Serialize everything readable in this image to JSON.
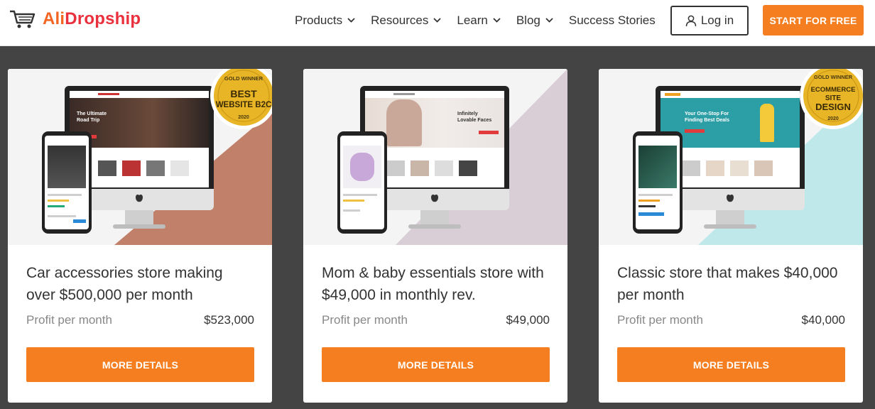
{
  "header": {
    "brand": {
      "part1": "Ali",
      "part2": "Dropship"
    },
    "nav": [
      {
        "label": "Products",
        "has_dropdown": true
      },
      {
        "label": "Resources",
        "has_dropdown": true
      },
      {
        "label": "Learn",
        "has_dropdown": true
      },
      {
        "label": "Blog",
        "has_dropdown": true
      },
      {
        "label": "Success Stories",
        "has_dropdown": false
      }
    ],
    "login_label": "Log in",
    "start_label": "START FOR FREE"
  },
  "cards": [
    {
      "title": "Car accessories store making over $500,000 per month",
      "profit_label": "Profit per month",
      "profit_value": "$523,000",
      "button_label": "MORE DETAILS",
      "badge": {
        "top": "GOLD WINNER",
        "line1": "BEST",
        "line2": "WEBSITE B2C",
        "year": "2020"
      },
      "hero_text": [
        "The Ultimate",
        "Road Trip"
      ],
      "accent_color": "#c1806a"
    },
    {
      "title": "Mom & baby essentials store with $49,000 in monthly rev.",
      "profit_label": "Profit per month",
      "profit_value": "$49,000",
      "button_label": "MORE DETAILS",
      "hero_text": [
        "Infinitely",
        "Lovable Faces"
      ],
      "accent_color": "#d9cdd6"
    },
    {
      "title": "Classic store that makes $40,000 per month",
      "profit_label": "Profit per month",
      "profit_value": "$40,000",
      "button_label": "MORE DETAILS",
      "badge": {
        "top": "GOLD WINNER",
        "line1": "ECOMMERCE",
        "line2": "SITE",
        "line3": "DESIGN",
        "year": "2020"
      },
      "hero_text": [
        "Your One-Stop For",
        "Finding Best Deals"
      ],
      "accent_color": "#bfe8ea"
    }
  ],
  "colors": {
    "brand_orange": "#f57f20",
    "brand_red": "#ea2f3d",
    "page_background": "#444444"
  }
}
